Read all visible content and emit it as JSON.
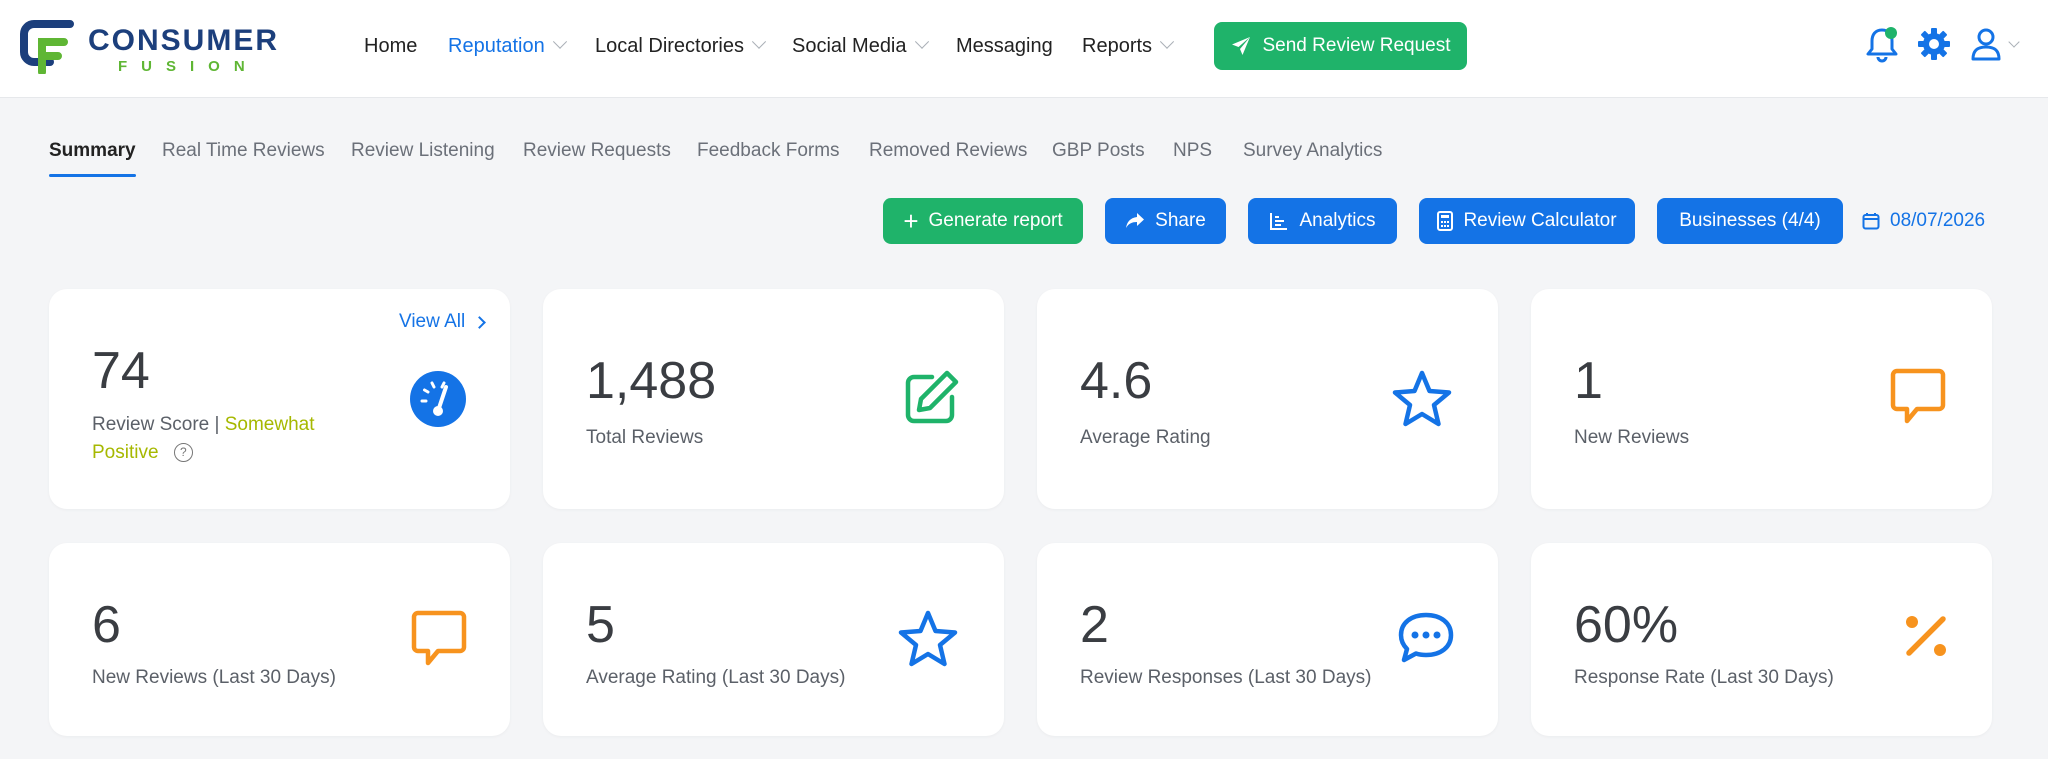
{
  "brand": {
    "word1": "CONSUMER",
    "word2": "FUSION"
  },
  "nav": [
    {
      "label": "Home",
      "active": false,
      "dropdown": false
    },
    {
      "label": "Reputation",
      "active": true,
      "dropdown": true
    },
    {
      "label": "Local Directories",
      "active": false,
      "dropdown": true
    },
    {
      "label": "Social Media",
      "active": false,
      "dropdown": true
    },
    {
      "label": "Messaging",
      "active": false,
      "dropdown": false
    },
    {
      "label": "Reports",
      "active": false,
      "dropdown": true
    }
  ],
  "send_button": {
    "label": "Send Review Request",
    "icon": "paper-plane-icon"
  },
  "header_icons": [
    "bell-icon",
    "gear-icon",
    "user-icon"
  ],
  "tabs": [
    {
      "label": "Summary",
      "active": true
    },
    {
      "label": "Real Time Reviews",
      "active": false
    },
    {
      "label": "Review Listening",
      "active": false
    },
    {
      "label": "Review Requests",
      "active": false
    },
    {
      "label": "Feedback Forms",
      "active": false
    },
    {
      "label": "Removed Reviews",
      "active": false
    },
    {
      "label": "GBP Posts",
      "active": false
    },
    {
      "label": "NPS",
      "active": false
    },
    {
      "label": "Survey Analytics",
      "active": false
    }
  ],
  "actions": {
    "generate_report": "Generate report",
    "share": "Share",
    "analytics": "Analytics",
    "review_calculator": "Review Calculator",
    "businesses": "Businesses (4/4)",
    "date": "08/07/2026"
  },
  "cards": {
    "review_score": {
      "value": "74",
      "label": "Review Score",
      "separator": "|",
      "sentiment": "Somewhat Positive",
      "view_all": "View All",
      "icon": "gauge-icon"
    },
    "total_reviews": {
      "value": "1,488",
      "label": "Total Reviews",
      "icon": "edit-icon"
    },
    "average_rating": {
      "value": "4.6",
      "label": "Average Rating",
      "icon": "star-icon"
    },
    "new_reviews": {
      "value": "1",
      "label": "New Reviews",
      "icon": "chat-icon"
    },
    "new_reviews_30": {
      "value": "6",
      "label": "New Reviews (Last 30 Days)",
      "icon": "chat-icon"
    },
    "average_rating_30": {
      "value": "5",
      "label": "Average Rating (Last 30 Days)",
      "icon": "star-icon"
    },
    "responses_30": {
      "value": "2",
      "label": "Review Responses (Last 30 Days)",
      "icon": "chat-dots-icon"
    },
    "response_rate_30": {
      "value": "60%",
      "label": "Response Rate (Last 30 Days)",
      "icon": "percent-icon"
    }
  },
  "colors": {
    "primary": "#1473e6",
    "green": "#1fb36a",
    "orange": "#f7931e",
    "sentiment": "#a6b800"
  }
}
